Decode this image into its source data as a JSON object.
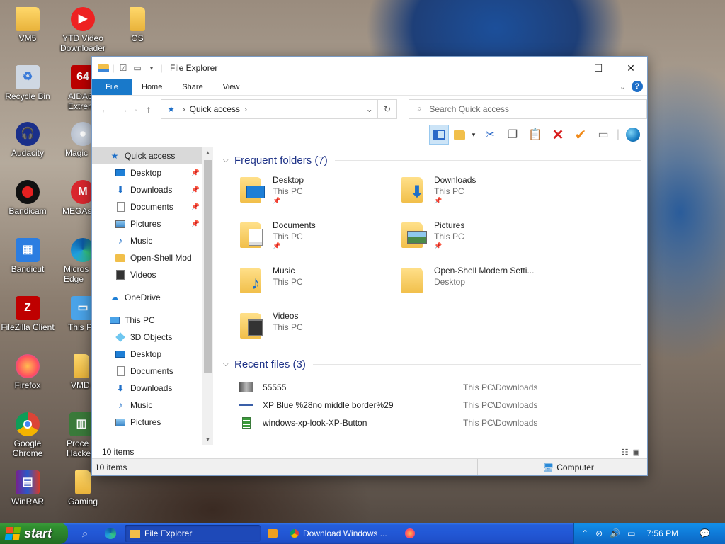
{
  "desktop": {
    "icons_col1": [
      {
        "label": "VM5",
        "icon": "folder-icon"
      },
      {
        "label": "Recycle Bin",
        "icon": "recycle-bin-icon"
      },
      {
        "label": "Audacity",
        "icon": "audacity-icon"
      },
      {
        "label": "Bandicam",
        "icon": "bandicam-icon"
      },
      {
        "label": "Bandicut",
        "icon": "bandicut-icon"
      },
      {
        "label": "FileZilla Client",
        "icon": "filezilla-icon"
      },
      {
        "label": "Firefox",
        "icon": "firefox-icon"
      },
      {
        "label": "Google Chrome",
        "icon": "chrome-icon"
      },
      {
        "label": "WinRAR",
        "icon": "winrar-icon"
      }
    ],
    "icons_col2": [
      {
        "label": "YTD Video Downloader",
        "icon": "ytd-icon"
      },
      {
        "label": "AIDA6 Extrem",
        "icon": "aida-icon"
      },
      {
        "label": "Magic",
        "icon": "magic-disc-icon"
      },
      {
        "label": "MEGAs",
        "icon": "mega-icon"
      },
      {
        "label": "Micros Edge",
        "icon": "edge-icon"
      },
      {
        "label": "This P",
        "icon": "this-pc-icon"
      },
      {
        "label": "VMD",
        "icon": "folder-icon"
      },
      {
        "label": "Proce Hacke",
        "icon": "process-hacker-icon"
      },
      {
        "label": "Gaming",
        "icon": "folder-icon"
      }
    ],
    "icon_os": {
      "label": "OS",
      "icon": "folder-icon"
    }
  },
  "window": {
    "title": "File Explorer",
    "ribbon_tabs": [
      "File",
      "Home",
      "Share",
      "View"
    ],
    "address": {
      "location": "Quick access"
    },
    "search": {
      "placeholder": "Search Quick access"
    },
    "nav_pane": [
      {
        "label": "Quick access",
        "icon": "star-icon",
        "indent": 1,
        "selected": true,
        "pinned": false
      },
      {
        "label": "Desktop",
        "icon": "desktop-icon",
        "indent": 2,
        "pinned": true
      },
      {
        "label": "Downloads",
        "icon": "download-icon",
        "indent": 2,
        "pinned": true
      },
      {
        "label": "Documents",
        "icon": "documents-icon",
        "indent": 2,
        "pinned": true
      },
      {
        "label": "Pictures",
        "icon": "pictures-icon",
        "indent": 2,
        "pinned": true
      },
      {
        "label": "Music",
        "icon": "music-icon",
        "indent": 2,
        "pinned": false
      },
      {
        "label": "Open-Shell Mod",
        "icon": "folder-icon",
        "indent": 2,
        "pinned": false
      },
      {
        "label": "Videos",
        "icon": "videos-icon",
        "indent": 2,
        "pinned": false
      },
      {
        "label": "",
        "icon": "",
        "indent": 0,
        "spacer": true
      },
      {
        "label": "OneDrive",
        "icon": "cloud-icon",
        "indent": 1,
        "pinned": false
      },
      {
        "label": "",
        "icon": "",
        "indent": 0,
        "spacer": true
      },
      {
        "label": "This PC",
        "icon": "pc-icon",
        "indent": 1,
        "pinned": false
      },
      {
        "label": "3D Objects",
        "icon": "cube-icon",
        "indent": 2,
        "pinned": false
      },
      {
        "label": "Desktop",
        "icon": "desktop-icon",
        "indent": 2,
        "pinned": false
      },
      {
        "label": "Documents",
        "icon": "documents-icon",
        "indent": 2,
        "pinned": false
      },
      {
        "label": "Downloads",
        "icon": "download-icon",
        "indent": 2,
        "pinned": false
      },
      {
        "label": "Music",
        "icon": "music-icon",
        "indent": 2,
        "pinned": false
      },
      {
        "label": "Pictures",
        "icon": "pictures-icon",
        "indent": 2,
        "pinned": false
      }
    ],
    "frequent": {
      "header": "Frequent folders (7)",
      "items": [
        {
          "name": "Desktop",
          "location": "This PC",
          "pinned": true,
          "icon": "desktop-icon"
        },
        {
          "name": "Downloads",
          "location": "This PC",
          "pinned": true,
          "icon": "download-icon"
        },
        {
          "name": "Documents",
          "location": "This PC",
          "pinned": true,
          "icon": "documents-icon"
        },
        {
          "name": "Pictures",
          "location": "This PC",
          "pinned": true,
          "icon": "pictures-icon"
        },
        {
          "name": "Music",
          "location": "This PC",
          "pinned": false,
          "icon": "music-icon"
        },
        {
          "name": "Open-Shell Modern Setti...",
          "location": "Desktop",
          "pinned": false,
          "icon": "folder-icon"
        },
        {
          "name": "Videos",
          "location": "This PC",
          "pinned": false,
          "icon": "videos-icon"
        }
      ]
    },
    "recent": {
      "header": "Recent files (3)",
      "items": [
        {
          "name": "55555",
          "path": "This PC\\Downloads",
          "icon": "image-file-icon"
        },
        {
          "name": "XP Blue %28no middle border%29",
          "path": "This PC\\Downloads",
          "icon": "bar-file-icon"
        },
        {
          "name": "windows-xp-look-XP-Button",
          "path": "This PC\\Downloads",
          "icon": "green-file-icon"
        }
      ]
    },
    "items_count": "10 items",
    "status": {
      "left": "10 items",
      "right": "Computer"
    }
  },
  "taskbar": {
    "start_label": "start",
    "tasks": [
      {
        "label": "File Explorer",
        "icon": "folder-icon",
        "active": true
      },
      {
        "label": "",
        "icon": "media-player-icon",
        "active": false
      },
      {
        "label": "Download Windows ...",
        "icon": "chrome-icon",
        "active": false
      },
      {
        "label": "",
        "icon": "firefox-icon",
        "active": false
      }
    ],
    "clock": "7:56 PM"
  },
  "colors": {
    "accent": "#1979ca",
    "group_header": "#1e3287",
    "taskbar": "#245edb",
    "start": "#2f8f2f",
    "tray": "#0f7ad8"
  }
}
